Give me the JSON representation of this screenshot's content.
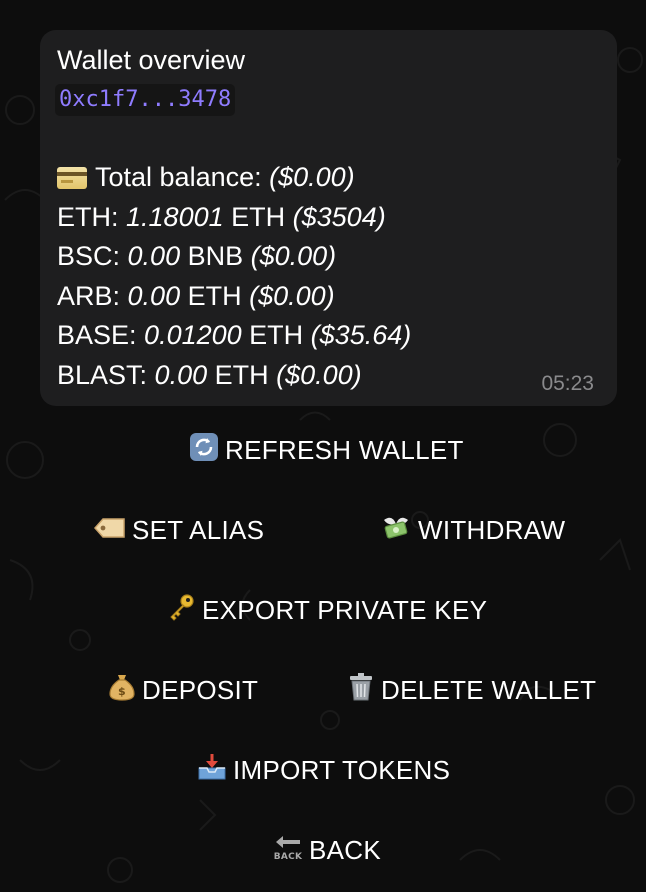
{
  "message": {
    "title": "Wallet overview",
    "address": "0xc1f7...3478",
    "timestamp": "05:23",
    "lines": [
      {
        "prefix": "Total balance: ",
        "amount": "",
        "unit": "",
        "usd": "($0.00)",
        "icon": "credit-card-icon"
      },
      {
        "prefix": "ETH: ",
        "amount": "1.18001",
        "unit": " ETH ",
        "usd": "($3504)"
      },
      {
        "prefix": "BSC: ",
        "amount": "0.00",
        "unit": " BNB ",
        "usd": "($0.00)"
      },
      {
        "prefix": "ARB: ",
        "amount": "0.00",
        "unit": " ETH ",
        "usd": "($0.00)"
      },
      {
        "prefix": "BASE: ",
        "amount": "0.01200",
        "unit": " ETH ",
        "usd": "($35.64)"
      },
      {
        "prefix": "BLAST: ",
        "amount": "0.00",
        "unit": " ETH ",
        "usd": "($0.00)"
      }
    ]
  },
  "keyboard": {
    "refresh": {
      "label": "REFRESH WALLET",
      "icon": "refresh-icon"
    },
    "set_alias": {
      "label": "SET ALIAS",
      "icon": "label-tag-icon"
    },
    "withdraw": {
      "label": "WITHDRAW",
      "icon": "money-with-wings-icon"
    },
    "export_key": {
      "label": "EXPORT PRIVATE KEY",
      "icon": "key-icon"
    },
    "deposit": {
      "label": "DEPOSIT",
      "icon": "money-bag-icon"
    },
    "delete_wallet": {
      "label": "DELETE WALLET",
      "icon": "trash-can-icon"
    },
    "import_tokens": {
      "label": "IMPORT TOKENS",
      "icon": "inbox-tray-icon"
    },
    "back": {
      "label": "BACK",
      "icon": "back-arrow-icon",
      "icon_text": "BACK"
    }
  },
  "colors": {
    "background": "#0d0d0d",
    "bubble": "#1e1e1f",
    "address": "#8f7cff",
    "timestamp": "#8a8a8c"
  }
}
